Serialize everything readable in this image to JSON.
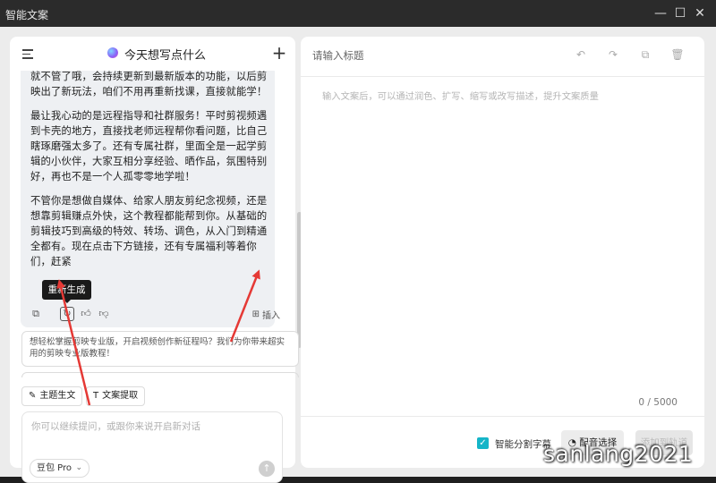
{
  "window": {
    "title": "智能文案",
    "minimize_icon": "minimize-icon",
    "maximize_icon": "maximize-icon",
    "close_icon": "close-icon"
  },
  "left_panel": {
    "header_title": "今天想写点什么",
    "plus_label": "+",
    "message": {
      "paragraphs": [
        "就不管了哦，会持续更新到最新版本的功能，以后剪映出了新玩法，咱们不用再重新找课，直接就能学！",
        "最让我心动的是远程指导和社群服务！平时剪视频遇到卡壳的地方，直接找老师远程帮你看问题，比自己瞎琢磨强太多了。还有专属社群，里面全是一起学剪辑的小伙伴，大家互相分享经验、晒作品，氛围特别好，再也不是一个人孤零零地学啦！",
        "不管你是想做自媒体、给家人朋友剪纪念视频，还是想靠剪辑赚点外快，这个教程都能帮到你。从基础的剪辑技巧到高级的特效、转场、调色，从入门到精通全都有。现在点击下方链接，还有专属福利等着你们，赶紧"
      ],
      "tooltip": "重新生成",
      "insert_label": "插入"
    },
    "suggestion": "想轻松掌握剪映专业版，开启视频创作新征程吗？我们为你带来超实用的剪映专业版教程！",
    "chips": [
      "主题生文",
      "文案提取"
    ],
    "input": {
      "placeholder": "你可以继续提问，或跟你来说开启新对话",
      "model": "豆包 Pro"
    }
  },
  "right_panel": {
    "title_placeholder": "请输入标题",
    "body_placeholder": "输入文案后，可以通过润色、扩写、缩写或改写描述，提升文案质量",
    "counter": "0 / 5000",
    "checkbox_label": "智能分割字幕",
    "dub_button": "配音选择",
    "add_button": "添加到轨道"
  },
  "watermark": "sanlang2021",
  "colors": {
    "accent": "#15b5c8",
    "arrow": "#e53935",
    "titlebar": "#2b2b2b"
  }
}
